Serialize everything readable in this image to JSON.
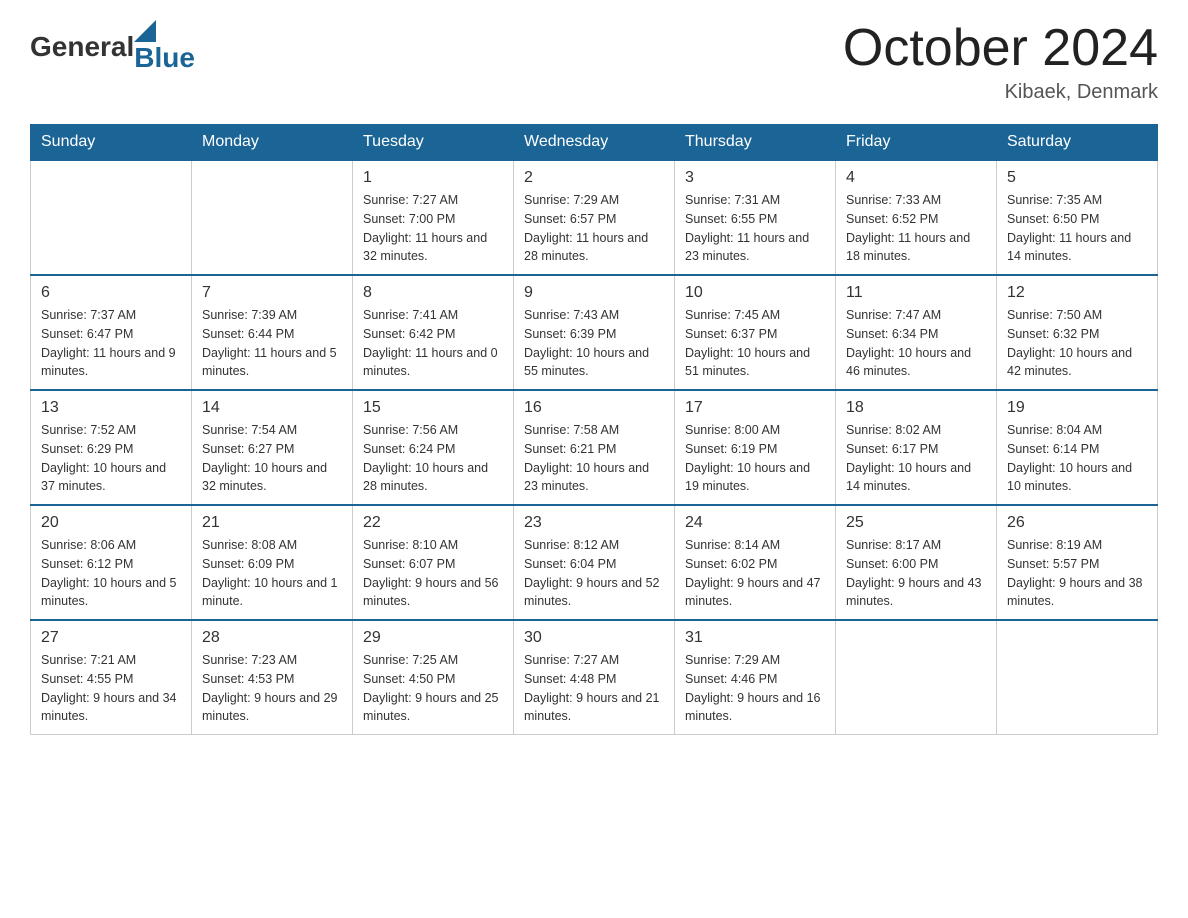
{
  "logo": {
    "general": "General",
    "blue": "Blue"
  },
  "title": {
    "month": "October 2024",
    "location": "Kibaek, Denmark"
  },
  "weekdays": [
    "Sunday",
    "Monday",
    "Tuesday",
    "Wednesday",
    "Thursday",
    "Friday",
    "Saturday"
  ],
  "weeks": [
    [
      {
        "day": "",
        "sunrise": "",
        "sunset": "",
        "daylight": ""
      },
      {
        "day": "",
        "sunrise": "",
        "sunset": "",
        "daylight": ""
      },
      {
        "day": "1",
        "sunrise": "Sunrise: 7:27 AM",
        "sunset": "Sunset: 7:00 PM",
        "daylight": "Daylight: 11 hours and 32 minutes."
      },
      {
        "day": "2",
        "sunrise": "Sunrise: 7:29 AM",
        "sunset": "Sunset: 6:57 PM",
        "daylight": "Daylight: 11 hours and 28 minutes."
      },
      {
        "day": "3",
        "sunrise": "Sunrise: 7:31 AM",
        "sunset": "Sunset: 6:55 PM",
        "daylight": "Daylight: 11 hours and 23 minutes."
      },
      {
        "day": "4",
        "sunrise": "Sunrise: 7:33 AM",
        "sunset": "Sunset: 6:52 PM",
        "daylight": "Daylight: 11 hours and 18 minutes."
      },
      {
        "day": "5",
        "sunrise": "Sunrise: 7:35 AM",
        "sunset": "Sunset: 6:50 PM",
        "daylight": "Daylight: 11 hours and 14 minutes."
      }
    ],
    [
      {
        "day": "6",
        "sunrise": "Sunrise: 7:37 AM",
        "sunset": "Sunset: 6:47 PM",
        "daylight": "Daylight: 11 hours and 9 minutes."
      },
      {
        "day": "7",
        "sunrise": "Sunrise: 7:39 AM",
        "sunset": "Sunset: 6:44 PM",
        "daylight": "Daylight: 11 hours and 5 minutes."
      },
      {
        "day": "8",
        "sunrise": "Sunrise: 7:41 AM",
        "sunset": "Sunset: 6:42 PM",
        "daylight": "Daylight: 11 hours and 0 minutes."
      },
      {
        "day": "9",
        "sunrise": "Sunrise: 7:43 AM",
        "sunset": "Sunset: 6:39 PM",
        "daylight": "Daylight: 10 hours and 55 minutes."
      },
      {
        "day": "10",
        "sunrise": "Sunrise: 7:45 AM",
        "sunset": "Sunset: 6:37 PM",
        "daylight": "Daylight: 10 hours and 51 minutes."
      },
      {
        "day": "11",
        "sunrise": "Sunrise: 7:47 AM",
        "sunset": "Sunset: 6:34 PM",
        "daylight": "Daylight: 10 hours and 46 minutes."
      },
      {
        "day": "12",
        "sunrise": "Sunrise: 7:50 AM",
        "sunset": "Sunset: 6:32 PM",
        "daylight": "Daylight: 10 hours and 42 minutes."
      }
    ],
    [
      {
        "day": "13",
        "sunrise": "Sunrise: 7:52 AM",
        "sunset": "Sunset: 6:29 PM",
        "daylight": "Daylight: 10 hours and 37 minutes."
      },
      {
        "day": "14",
        "sunrise": "Sunrise: 7:54 AM",
        "sunset": "Sunset: 6:27 PM",
        "daylight": "Daylight: 10 hours and 32 minutes."
      },
      {
        "day": "15",
        "sunrise": "Sunrise: 7:56 AM",
        "sunset": "Sunset: 6:24 PM",
        "daylight": "Daylight: 10 hours and 28 minutes."
      },
      {
        "day": "16",
        "sunrise": "Sunrise: 7:58 AM",
        "sunset": "Sunset: 6:21 PM",
        "daylight": "Daylight: 10 hours and 23 minutes."
      },
      {
        "day": "17",
        "sunrise": "Sunrise: 8:00 AM",
        "sunset": "Sunset: 6:19 PM",
        "daylight": "Daylight: 10 hours and 19 minutes."
      },
      {
        "day": "18",
        "sunrise": "Sunrise: 8:02 AM",
        "sunset": "Sunset: 6:17 PM",
        "daylight": "Daylight: 10 hours and 14 minutes."
      },
      {
        "day": "19",
        "sunrise": "Sunrise: 8:04 AM",
        "sunset": "Sunset: 6:14 PM",
        "daylight": "Daylight: 10 hours and 10 minutes."
      }
    ],
    [
      {
        "day": "20",
        "sunrise": "Sunrise: 8:06 AM",
        "sunset": "Sunset: 6:12 PM",
        "daylight": "Daylight: 10 hours and 5 minutes."
      },
      {
        "day": "21",
        "sunrise": "Sunrise: 8:08 AM",
        "sunset": "Sunset: 6:09 PM",
        "daylight": "Daylight: 10 hours and 1 minute."
      },
      {
        "day": "22",
        "sunrise": "Sunrise: 8:10 AM",
        "sunset": "Sunset: 6:07 PM",
        "daylight": "Daylight: 9 hours and 56 minutes."
      },
      {
        "day": "23",
        "sunrise": "Sunrise: 8:12 AM",
        "sunset": "Sunset: 6:04 PM",
        "daylight": "Daylight: 9 hours and 52 minutes."
      },
      {
        "day": "24",
        "sunrise": "Sunrise: 8:14 AM",
        "sunset": "Sunset: 6:02 PM",
        "daylight": "Daylight: 9 hours and 47 minutes."
      },
      {
        "day": "25",
        "sunrise": "Sunrise: 8:17 AM",
        "sunset": "Sunset: 6:00 PM",
        "daylight": "Daylight: 9 hours and 43 minutes."
      },
      {
        "day": "26",
        "sunrise": "Sunrise: 8:19 AM",
        "sunset": "Sunset: 5:57 PM",
        "daylight": "Daylight: 9 hours and 38 minutes."
      }
    ],
    [
      {
        "day": "27",
        "sunrise": "Sunrise: 7:21 AM",
        "sunset": "Sunset: 4:55 PM",
        "daylight": "Daylight: 9 hours and 34 minutes."
      },
      {
        "day": "28",
        "sunrise": "Sunrise: 7:23 AM",
        "sunset": "Sunset: 4:53 PM",
        "daylight": "Daylight: 9 hours and 29 minutes."
      },
      {
        "day": "29",
        "sunrise": "Sunrise: 7:25 AM",
        "sunset": "Sunset: 4:50 PM",
        "daylight": "Daylight: 9 hours and 25 minutes."
      },
      {
        "day": "30",
        "sunrise": "Sunrise: 7:27 AM",
        "sunset": "Sunset: 4:48 PM",
        "daylight": "Daylight: 9 hours and 21 minutes."
      },
      {
        "day": "31",
        "sunrise": "Sunrise: 7:29 AM",
        "sunset": "Sunset: 4:46 PM",
        "daylight": "Daylight: 9 hours and 16 minutes."
      },
      {
        "day": "",
        "sunrise": "",
        "sunset": "",
        "daylight": ""
      },
      {
        "day": "",
        "sunrise": "",
        "sunset": "",
        "daylight": ""
      }
    ]
  ]
}
